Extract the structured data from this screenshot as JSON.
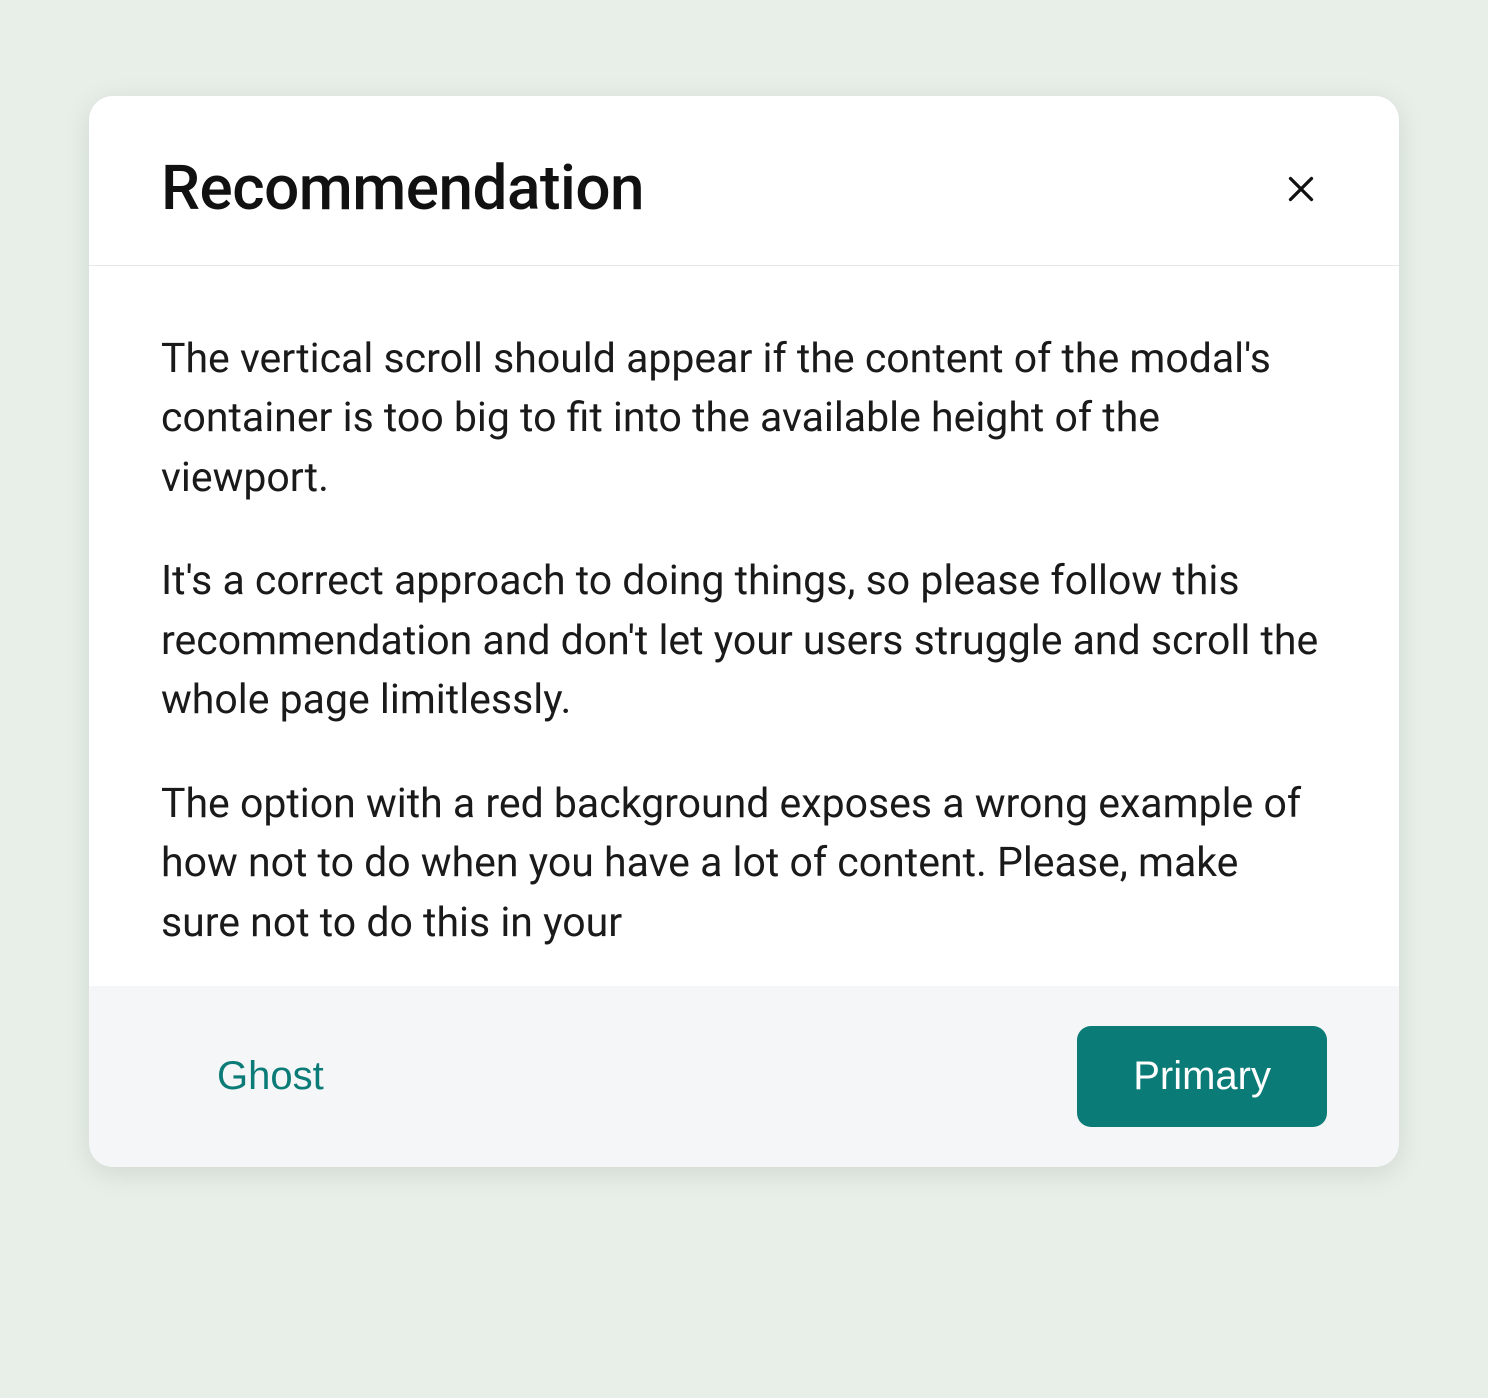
{
  "modal": {
    "title": "Recommendation",
    "body": {
      "paragraphs": [
        "The vertical scroll should appear if the content of the modal's container is too big to fit into the available height of the viewport.",
        "It's a correct approach to doing things, so please follow this recommendation and don't let your users struggle and scroll the whole page limitlessly.",
        "The option with a red background exposes a wrong example of how not to do when you have a lot of content. Please, make sure not to do this in your"
      ]
    },
    "footer": {
      "ghost_label": "Ghost",
      "primary_label": "Primary"
    }
  },
  "colors": {
    "backdrop": "#e7efe8",
    "accent": "#0b7b77",
    "footer_bg": "#f5f6f7",
    "text": "#1a1a1a"
  }
}
